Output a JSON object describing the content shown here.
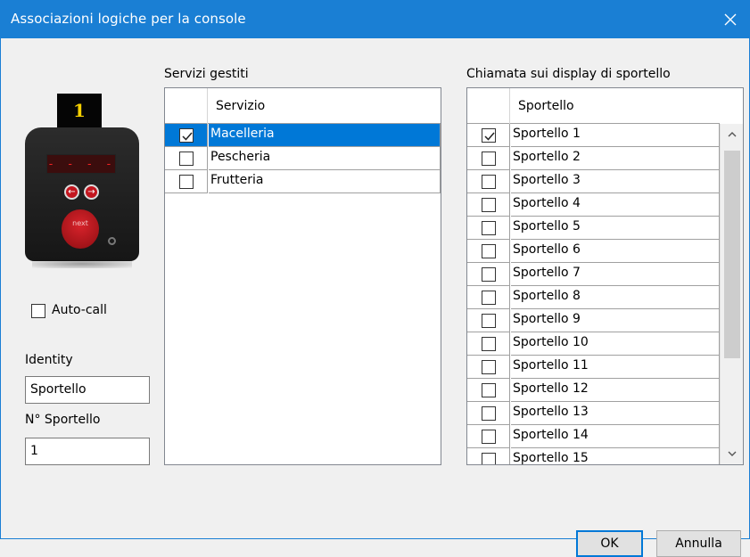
{
  "window": {
    "title": "Associazioni logiche per la console",
    "close_icon": "close-icon"
  },
  "device": {
    "badge_number": "1",
    "display_text": "- - - -",
    "left_arrow": "←",
    "right_arrow": "→",
    "next_label": "next",
    "accent_color": "#c3161f"
  },
  "autocall": {
    "label": "Auto-call",
    "checked": false
  },
  "identity": {
    "label": "Identity",
    "value": "Sportello"
  },
  "sportello_num": {
    "label": "N° Sportello",
    "value": "1"
  },
  "services": {
    "group_label": "Servizi gestiti",
    "column_header": "Servizio",
    "rows": [
      {
        "name": "Macelleria",
        "checked": true,
        "selected": true
      },
      {
        "name": "Pescheria",
        "checked": false,
        "selected": false
      },
      {
        "name": "Frutteria",
        "checked": false,
        "selected": false
      }
    ]
  },
  "displays": {
    "group_label": "Chiamata sui display di sportello",
    "column_header": "Sportello",
    "rows": [
      {
        "name": "Sportello 1",
        "checked": true
      },
      {
        "name": "Sportello 2",
        "checked": false
      },
      {
        "name": "Sportello 3",
        "checked": false
      },
      {
        "name": "Sportello 4",
        "checked": false
      },
      {
        "name": "Sportello 5",
        "checked": false
      },
      {
        "name": "Sportello 6",
        "checked": false
      },
      {
        "name": "Sportello 7",
        "checked": false
      },
      {
        "name": "Sportello 8",
        "checked": false
      },
      {
        "name": "Sportello 9",
        "checked": false
      },
      {
        "name": "Sportello 10",
        "checked": false
      },
      {
        "name": "Sportello 11",
        "checked": false
      },
      {
        "name": "Sportello 12",
        "checked": false
      },
      {
        "name": "Sportello 13",
        "checked": false
      },
      {
        "name": "Sportello 14",
        "checked": false
      },
      {
        "name": "Sportello 15",
        "checked": false
      }
    ]
  },
  "buttons": {
    "ok": "OK",
    "cancel": "Annulla"
  }
}
